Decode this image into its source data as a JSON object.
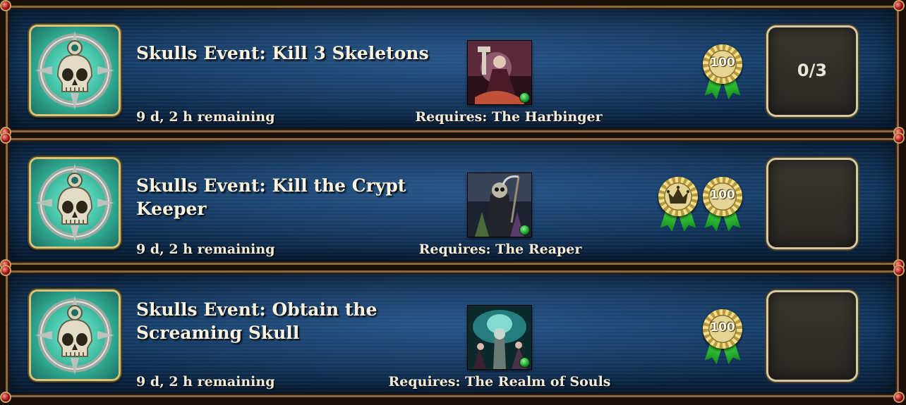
{
  "quests": [
    {
      "title": "Skulls Event: Kill 3 Skeletons",
      "remaining": "9 d, 2 h remaining",
      "requires": "Requires: The Harbinger",
      "rewards": [
        {
          "type": "medal",
          "value": "100"
        }
      ],
      "progress": "0/3"
    },
    {
      "title": "Skulls Event: Kill the Crypt Keeper",
      "remaining": "9 d, 2 h remaining",
      "requires": "Requires: The Reaper",
      "rewards": [
        {
          "type": "crown-icon"
        },
        {
          "type": "medal",
          "value": "100"
        }
      ],
      "progress": ""
    },
    {
      "title": "Skulls Event: Obtain the Screaming Skull",
      "remaining": "9 d, 2 h remaining",
      "requires": "Requires: The Realm of Souls",
      "rewards": [
        {
          "type": "medal",
          "value": "100"
        }
      ],
      "progress": ""
    }
  ],
  "colors": {
    "panel": "#123a63",
    "frame_gold": "#8a6a3c",
    "icon_teal": "#33b49a",
    "ribbon_green": "#1fae2a",
    "medal_gold": "#e5d493"
  }
}
